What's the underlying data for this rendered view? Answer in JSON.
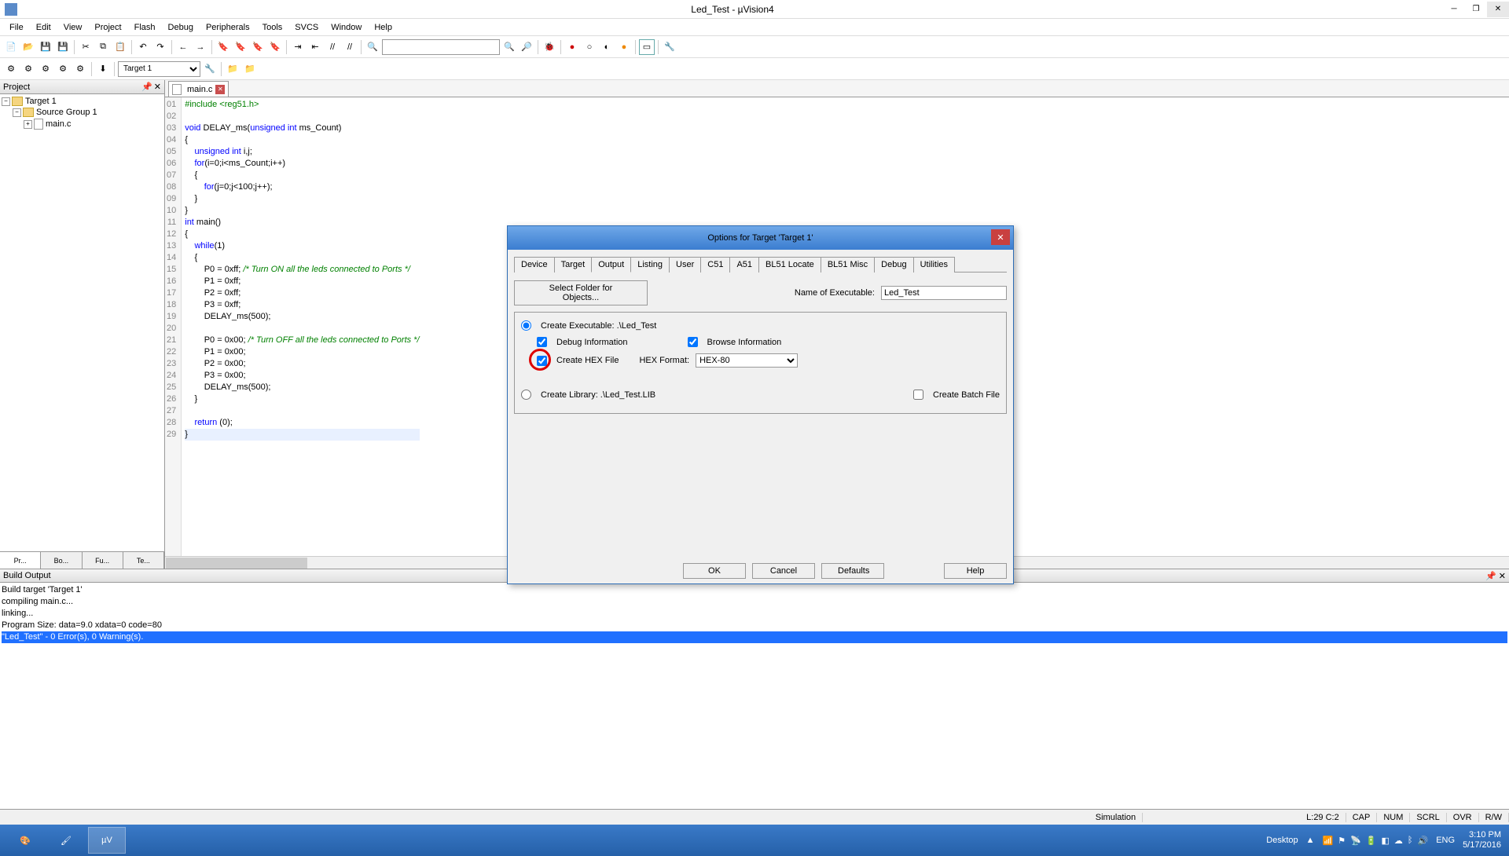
{
  "window": {
    "title": "Led_Test  - µVision4"
  },
  "menu": [
    "File",
    "Edit",
    "View",
    "Project",
    "Flash",
    "Debug",
    "Peripherals",
    "Tools",
    "SVCS",
    "Window",
    "Help"
  ],
  "target_combo": "Target 1",
  "project_panel": {
    "title": "Project",
    "root": "Target 1",
    "group": "Source Group 1",
    "file": "main.c"
  },
  "sidebar_tabs": [
    "Pr...",
    "Bo...",
    "Fu...",
    "Te..."
  ],
  "file_tab": "main.c",
  "code_lines": [
    "#include <reg51.h>",
    "",
    "void DELAY_ms(unsigned int ms_Count)",
    "{",
    "    unsigned int i,j;",
    "    for(i=0;i<ms_Count;i++)",
    "    {",
    "        for(j=0;j<100;j++);",
    "    }",
    "}",
    "int main()",
    "{",
    "    while(1)",
    "    {",
    "        P0 = 0xff; /* Turn ON all the leds connected to Ports */",
    "        P1 = 0xff;",
    "        P2 = 0xff;",
    "        P3 = 0xff;",
    "        DELAY_ms(500);",
    "",
    "        P0 = 0x00; /* Turn OFF all the leds connected to Ports */",
    "        P1 = 0x00;",
    "        P2 = 0x00;",
    "        P3 = 0x00;",
    "        DELAY_ms(500);",
    "    }",
    "",
    "    return (0);",
    "}"
  ],
  "build_panel": {
    "title": "Build Output"
  },
  "build_lines": [
    "Build target 'Target 1'",
    "compiling main.c...",
    "linking...",
    "Program Size: data=9.0 xdata=0 code=80",
    "\"Led_Test\" - 0 Error(s), 0 Warning(s)."
  ],
  "status": {
    "sim": "Simulation",
    "pos": "L:29 C:2",
    "caps": "CAP",
    "num": "NUM",
    "scrl": "SCRL",
    "ovr": "OVR",
    "rw": "R/W"
  },
  "dialog": {
    "title": "Options for Target 'Target 1'",
    "tabs": [
      "Device",
      "Target",
      "Output",
      "Listing",
      "User",
      "C51",
      "A51",
      "BL51 Locate",
      "BL51 Misc",
      "Debug",
      "Utilities"
    ],
    "active_tab": "Output",
    "select_folder_btn": "Select Folder for Objects...",
    "name_exec_label": "Name of Executable:",
    "name_exec_value": "Led_Test",
    "create_exec_label": "Create Executable:  .\\Led_Test",
    "debug_info_label": "Debug Information",
    "browse_info_label": "Browse Information",
    "create_hex_label": "Create HEX File",
    "hex_format_label": "HEX Format:",
    "hex_format_value": "HEX-80",
    "create_lib_label": "Create Library:  .\\Led_Test.LIB",
    "create_batch_label": "Create Batch File",
    "buttons": {
      "ok": "OK",
      "cancel": "Cancel",
      "defaults": "Defaults",
      "help": "Help"
    }
  },
  "taskbar": {
    "desktop": "Desktop",
    "lang": "ENG",
    "time": "3:10 PM",
    "date": "5/17/2016"
  }
}
